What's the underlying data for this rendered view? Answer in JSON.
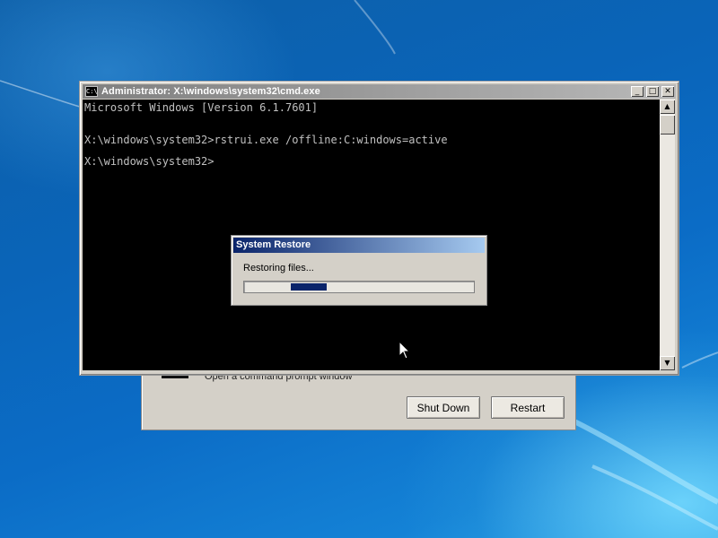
{
  "cmd_window": {
    "title": "Administrator: X:\\windows\\system32\\cmd.exe",
    "icon_label": "C:\\",
    "controls": {
      "minimize": "_",
      "maximize": "□",
      "close": "✕"
    },
    "lines": [
      "Microsoft Windows [Version 6.1.7601]",
      "X:\\windows\\system32>rstrui.exe /offline:C:windows=active",
      "X:\\windows\\system32>"
    ]
  },
  "restore_dialog": {
    "title": "System Restore",
    "status": "Restoring files...",
    "progress_marquee_position": 0.2
  },
  "recovery_window": {
    "option_text": "Open a command prompt window",
    "shutdown_label": "Shut Down",
    "restart_label": "Restart"
  },
  "icons": {
    "cursor": "arrow-cursor-icon",
    "cmd": "command-prompt-icon"
  }
}
